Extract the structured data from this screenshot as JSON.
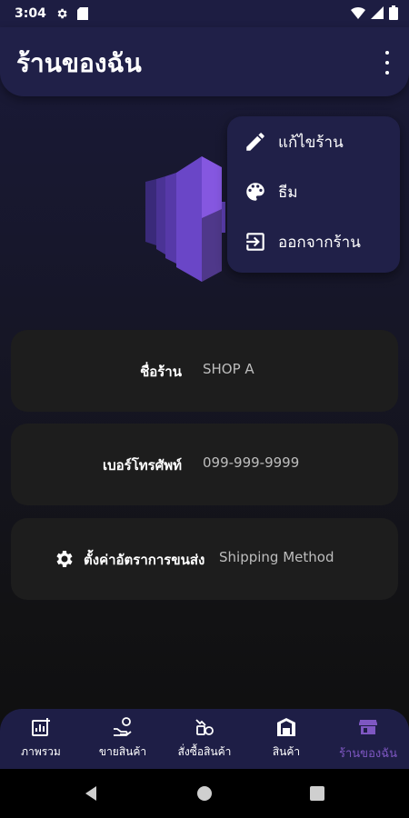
{
  "status_bar": {
    "time": "3:04",
    "icons_left": [
      "gear-icon",
      "sim-card-icon"
    ],
    "icons_right": [
      "wifi-icon",
      "signal-icon",
      "battery-icon"
    ]
  },
  "app_bar": {
    "title": "ร้านของฉัน",
    "more_icon": "more-vert-icon"
  },
  "popup_menu": {
    "items": [
      {
        "label": "แก้ไขร้าน",
        "icon": "edit-icon"
      },
      {
        "label": "ธีม",
        "icon": "palette-icon"
      },
      {
        "label": "ออกจากร้าน",
        "icon": "exit-icon"
      }
    ]
  },
  "shop_info": {
    "name": {
      "label": "ชื่อร้าน",
      "value": "SHOP A"
    },
    "phone": {
      "label": "เบอร์โทรศัพท์",
      "value": "099-999-9999"
    },
    "shipping": {
      "label": "ตั้งค่าอัตราการขนส่ง",
      "value": "Shipping Method",
      "icon": "gear-icon"
    }
  },
  "bottom_nav": {
    "items": [
      {
        "label": "ภาพรวม",
        "icon": "dashboard-icon"
      },
      {
        "label": "ขายสินค้า",
        "icon": "sell-icon"
      },
      {
        "label": "สั่งซื้อสินค้า",
        "icon": "order-icon"
      },
      {
        "label": "สินค้า",
        "icon": "warehouse-icon"
      },
      {
        "label": "ร้านของฉัน",
        "icon": "store-icon"
      }
    ],
    "active_index": 4
  },
  "colors": {
    "accent": "#7e57c2",
    "app_bar_bg": "#202048",
    "card_bg": "#1d1d1d"
  }
}
